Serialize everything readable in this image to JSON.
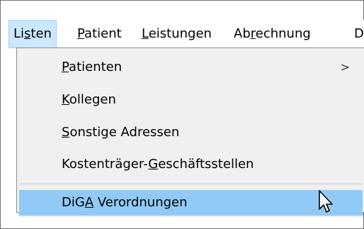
{
  "menubar": {
    "items": [
      {
        "pre": "Li",
        "ul": "s",
        "post": "ten"
      },
      {
        "pre": "",
        "ul": "P",
        "post": "atient"
      },
      {
        "pre": "",
        "ul": "L",
        "post": "eistungen"
      },
      {
        "pre": "Ab",
        "ul": "r",
        "post": "echnung"
      },
      {
        "pre": "",
        "ul": "",
        "post": "D"
      }
    ]
  },
  "dropdown": {
    "items": [
      {
        "pre": "",
        "ul": "P",
        "post": "atienten",
        "submenu_arrow": ">"
      },
      {
        "pre": "",
        "ul": "K",
        "post": "ollegen"
      },
      {
        "pre": "",
        "ul": "S",
        "post": "onstige Adressen"
      },
      {
        "pre": "Kostenträger-",
        "ul": "G",
        "post": "eschäftsstellen"
      },
      {
        "pre": "DiG",
        "ul": "A",
        "post": " Verordnungen"
      }
    ]
  },
  "colors": {
    "menubar_active_bg": "#cce8ff",
    "dropdown_bg": "#f0f0f0",
    "highlight_bg": "#91c9f7"
  },
  "icons": {
    "cursor": "mouse-pointer-arrow-icon"
  }
}
